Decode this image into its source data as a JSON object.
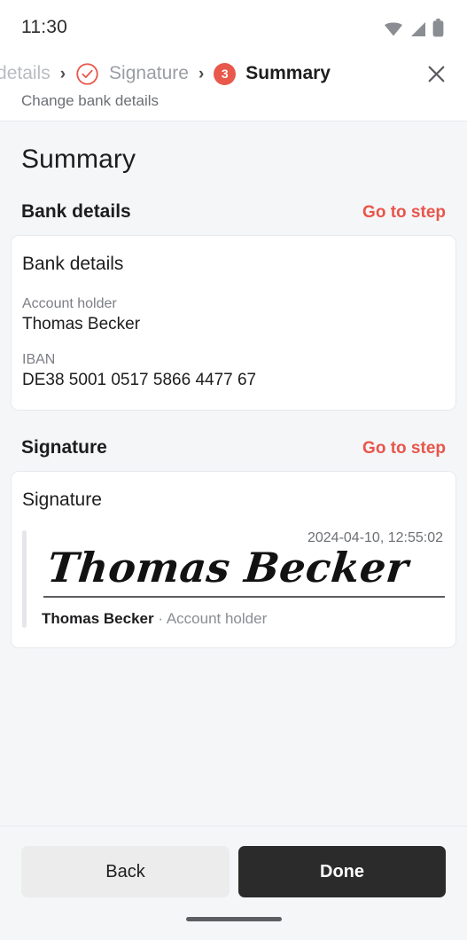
{
  "statusbar": {
    "time": "11:30",
    "icons": [
      "wifi-icon",
      "cellular-signal-icon",
      "battery-icon"
    ]
  },
  "header": {
    "breadcrumbs": [
      {
        "label": "nk details",
        "state": "truncated-past",
        "icon": null
      },
      {
        "label": "Signature",
        "state": "completed",
        "icon": "check-circle-icon"
      },
      {
        "label": "Summary",
        "state": "current",
        "icon": "step-badge",
        "step": "3"
      }
    ],
    "chevron": "›",
    "close_icon": "close-icon",
    "subtitle": "Change bank details"
  },
  "main": {
    "title": "Summary",
    "sections": [
      {
        "heading": "Bank details",
        "action_label": "Go to step",
        "card_title": "Bank details",
        "fields": [
          {
            "label": "Account holder",
            "value": "Thomas Becker"
          },
          {
            "label": "IBAN",
            "value": "DE38 5001 0517 5866 4477 67"
          }
        ]
      },
      {
        "heading": "Signature",
        "action_label": "Go to step",
        "card_title": "Signature",
        "signature": {
          "timestamp": "2024-04-10, 12:55:02",
          "drawn_name": "Thomas Becker",
          "signer_name": "Thomas Becker",
          "separator": "·",
          "signer_role": "Account holder"
        }
      }
    ]
  },
  "footer": {
    "back_label": "Back",
    "done_label": "Done"
  },
  "colors": {
    "accent_red": "#e8564a",
    "badge_red": "#e8584b",
    "page_bg": "#f5f6f8",
    "card_bg": "#ffffff",
    "text_primary": "#1d1d1f",
    "text_muted": "#7b7e84",
    "done_button_bg": "#2b2b2b",
    "back_button_bg": "#ececec"
  }
}
